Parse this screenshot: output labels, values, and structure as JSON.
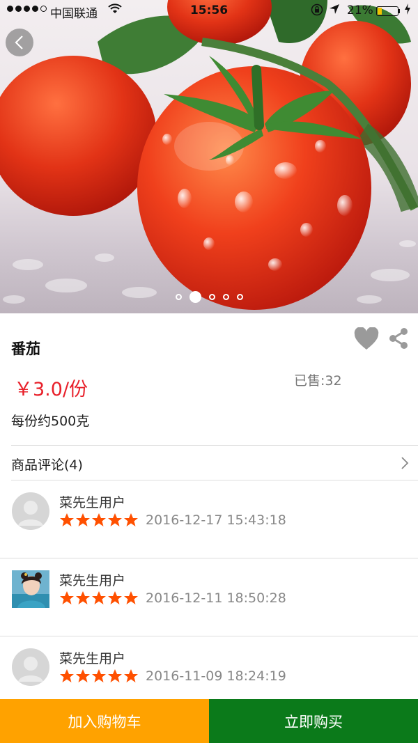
{
  "status_bar": {
    "carrier": "中国联通",
    "time": "15:56",
    "battery_percent": "21%",
    "battery_level": 0.21,
    "battery_color": "#f2c200",
    "icons": [
      "signal-dots-icon",
      "wifi-icon",
      "lock-rotation-icon",
      "location-arrow-icon",
      "battery-icon",
      "charging-icon"
    ]
  },
  "hero": {
    "image": "tomato-photo",
    "page_count": 5,
    "active_page": 1
  },
  "product": {
    "name": "番茄",
    "price": "￥3.0/份",
    "sold": "已售:32",
    "spec": "每份约500克",
    "price_color": "#e8202a"
  },
  "reviews": {
    "header": "商品评论(4)",
    "items": [
      {
        "user": "菜先生用户",
        "rating": 5,
        "date": "2016-12-17 15:43:18",
        "avatar": "default-avatar"
      },
      {
        "user": "菜先生用户",
        "rating": 5,
        "date": "2016-12-11 18:50:28",
        "avatar": "photo-avatar"
      },
      {
        "user": "菜先生用户",
        "rating": 5,
        "date": "2016-11-09 18:24:19",
        "avatar": "default-avatar"
      }
    ]
  },
  "actions": {
    "add_to_cart": "加入购物车",
    "buy_now": "立即购买",
    "add_to_cart_color": "#ffa200",
    "buy_now_color": "#0b7a1a"
  },
  "star_color": "#ff5000"
}
